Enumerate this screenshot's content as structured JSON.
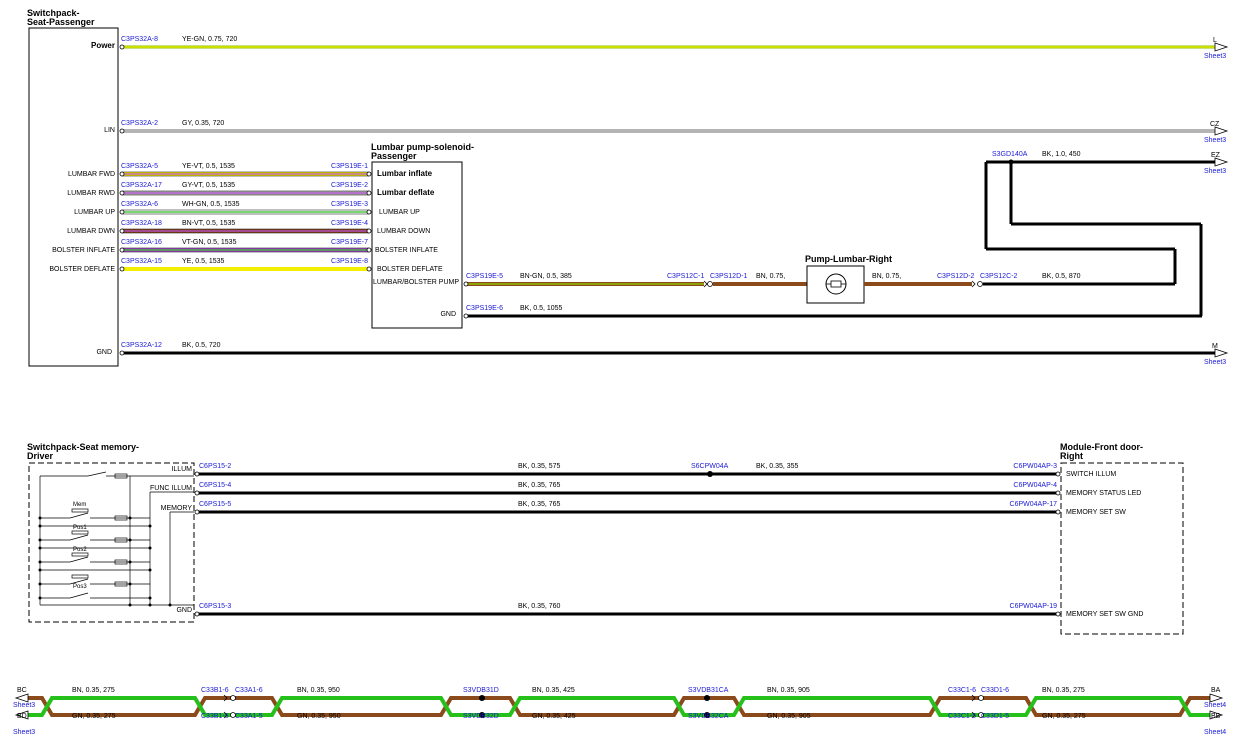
{
  "comp": {
    "switchpack_passenger": [
      "Switchpack-",
      "Seat-Passenger"
    ],
    "lumbar_pump_solenoid": [
      "Lumbar pump-solenoid-",
      "Passenger"
    ],
    "pump_lumbar_right": "Pump-Lumbar-Right",
    "switchpack_memory_driver": [
      "Switchpack-Seat memory-",
      "Driver"
    ],
    "module_front_door_right": [
      "Module-Front door-",
      "Right"
    ]
  },
  "pins": {
    "power": "Power",
    "lin": "LIN",
    "lumbar_fwd": "LUMBAR FWD",
    "lumbar_rwd": "LUMBAR RWD",
    "lumbar_up": "LUMBAR UP",
    "lumbar_dwn": "LUMBAR DWN",
    "bolster_inflate": "BOLSTER INFLATE",
    "bolster_deflate": "BOLSTER DEFLATE",
    "gnd": "GND",
    "lumbar_inflate": "Lumbar inflate",
    "lumbar_deflate": "Lumbar deflate",
    "lumbar_up_r": "LUMBAR UP",
    "lumbar_down_r": "LUMBAR DOWN",
    "bolster_inflate_r": "BOLSTER INFLATE",
    "bolster_deflate_r": "BOLSTER DEFLATE",
    "lumbar_bolster_pump": "LUMBAR/BOLSTER PUMP",
    "pump_gnd": "GND",
    "illum": "ILLUM",
    "func_illum": "FUNC ILLUM",
    "memory": "MEMORY",
    "mem_gnd": "GND",
    "switch_illum": "SWITCH ILLUM",
    "memory_status_led": "MEMORY STATUS LED",
    "memory_set_sw": "MEMORY SET SW",
    "memory_set_sw_gnd": "MEMORY SET SW GND",
    "mem": "Mem",
    "pos1": "Pos1",
    "pos2": "Pos2",
    "pos3": "Pos3"
  },
  "conn": {
    "c1": "C3PS32A-8",
    "c2": "C3PS32A-2",
    "c3": "C3PS32A-5",
    "c4": "C3PS32A-17",
    "c5": "C3PS32A-6",
    "c6": "C3PS32A-18",
    "c7": "C3PS32A-16",
    "c8": "C3PS32A-15",
    "c9": "C3PS32A-12",
    "e1": "C3PS19E-1",
    "e2": "C3PS19E-2",
    "e3": "C3PS19E-3",
    "e4": "C3PS19E-4",
    "e7": "C3PS19E-7",
    "e8": "C3PS19E-8",
    "e5": "C3PS19E-5",
    "e6": "C3PS19E-6",
    "p12c1": "C3PS12C-1",
    "p12d1": "C3PS12D-1",
    "p12d2": "C3PS12D-2",
    "p12c2": "C3PS12C-2",
    "s3gd": "S3GD140A",
    "m1": "C6PS15-2",
    "m2": "C6PS15-4",
    "m3": "C6PS15-5",
    "m4": "C6PS15-3",
    "s6": "S6CPW04A",
    "d1": "C6PW04AP-3",
    "d2": "C6PW04AP-4",
    "d3": "C6PW04AP-17",
    "d4": "C6PW04AP-19",
    "b1": "C33B1-6",
    "b2": "C33A1-6",
    "b3": "C33B1-5",
    "b4": "C33A1-5",
    "v1": "S3VDB31D",
    "v2": "S3VDB32D",
    "v3": "S3VDB31CA",
    "v4": "S3VDB32CA",
    "x1": "C33C1-6",
    "x2": "C33D1-6",
    "x3": "C33C1-5",
    "x4": "C33D1-5"
  },
  "wire": {
    "w1": "YE-GN,  0.75,  720",
    "w2": "GY,  0.35,  720",
    "w3": "YE-VT,  0.5,  1535",
    "w4": "GY-VT,  0.5,  1535",
    "w5": "WH-GN,  0.5,  1535",
    "w6": "BN-VT,  0.5,  1535",
    "w7": "VT-GN,  0.5,  1535",
    "w8": "YE,  0.5,  1535",
    "w9": "BK,  0.5,  720",
    "w10": "BN-GN,  0.5,  385",
    "w11": "BN,  0.75,",
    "w12": "BN,  0.75,",
    "w13": "BK,  0.5,  870",
    "w14": "BK,  1.0,  450",
    "w15": "BK,  0.5,  1055",
    "m1a": "BK,  0.35,  575",
    "m1b": "BK,  0.35,  355",
    "m2": "BK,  0.35,  765",
    "m3": "BK,  0.35,  765",
    "m4": "BK,  0.35,  760",
    "bn1": "BN,  0.35,  275",
    "gn1": "GN,  0.35,  275",
    "bn2": "BN,  0.35,  950",
    "gn2": "GN,  0.35,  950",
    "bn3": "BN,  0.35,  425",
    "gn3": "GN,  0.35,  425",
    "bn4": "BN,  0.35,  905",
    "gn4": "GN,  0.35,  905",
    "bn5": "BN,  0.35,  275",
    "gn5": "GN,  0.35,  275"
  },
  "ref": {
    "L": "L",
    "CZ": "CZ",
    "EZ": "EZ",
    "M": "M",
    "BC": "BC",
    "BD": "BD",
    "BA": "BA",
    "BB": "BB",
    "sheet3": "Sheet3",
    "sheet4": "Sheet4"
  },
  "colors": {
    "ye": "#f2ef00",
    "gn": "#26c01a",
    "gy": "#b4b4b4",
    "bn": "#8a4a1c",
    "vt": "#b44ad8",
    "wh": "#ffffff",
    "bk": "#000000",
    "conn": "#1a1ad6"
  }
}
